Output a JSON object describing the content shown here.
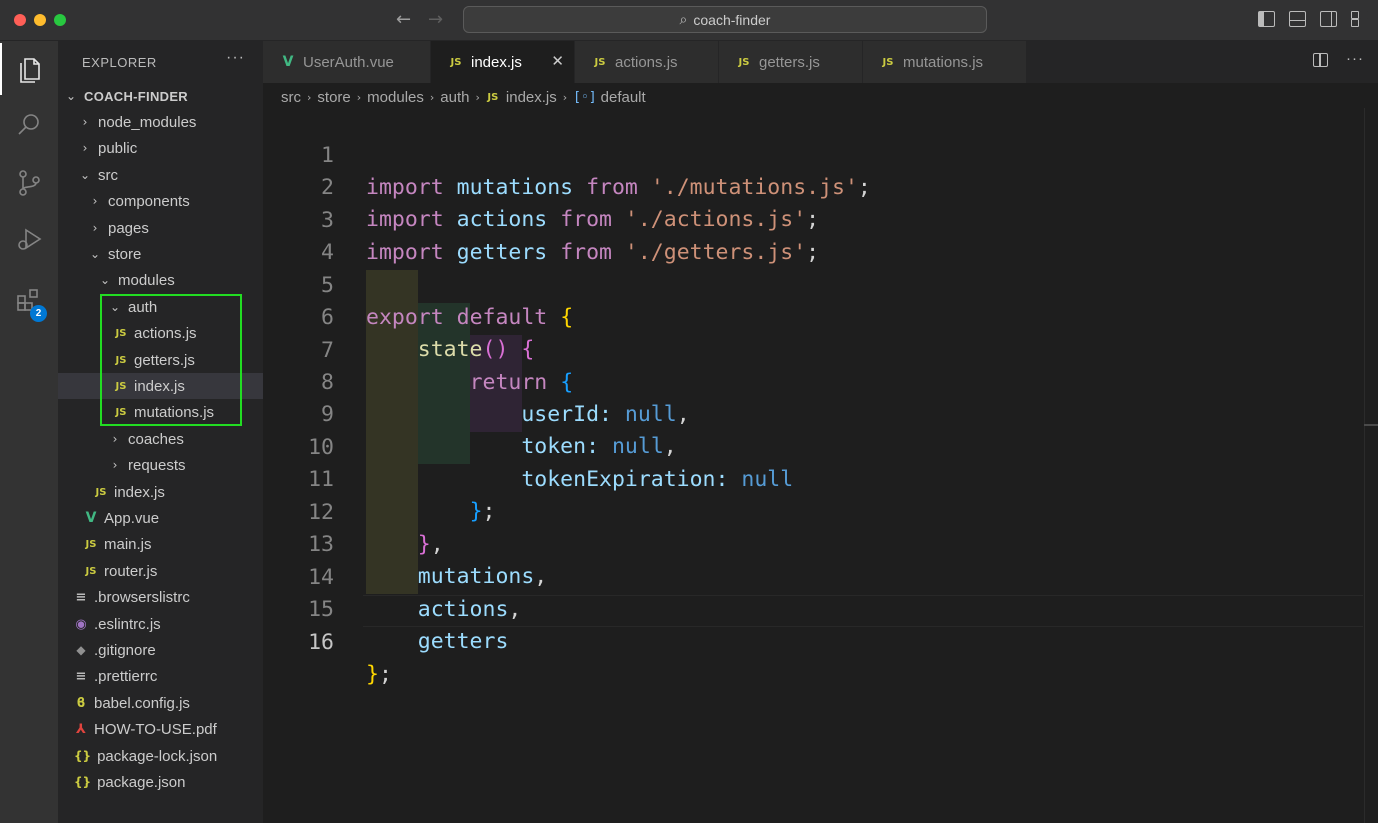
{
  "window": {
    "search_label": "coach-finder"
  },
  "activity": {
    "extensions_badge": "2"
  },
  "explorer": {
    "header": "EXPLORER",
    "more": "···",
    "root": "COACH-FINDER",
    "items": [
      {
        "label": "node_modules",
        "type": "folder",
        "expanded": false
      },
      {
        "label": "public",
        "type": "folder",
        "expanded": false
      },
      {
        "label": "src",
        "type": "folder",
        "expanded": true
      },
      {
        "label": "components",
        "type": "folder",
        "expanded": false
      },
      {
        "label": "pages",
        "type": "folder",
        "expanded": false
      },
      {
        "label": "store",
        "type": "folder",
        "expanded": true
      },
      {
        "label": "modules",
        "type": "folder",
        "expanded": true
      },
      {
        "label": "auth",
        "type": "folder",
        "expanded": true
      },
      {
        "label": "actions.js",
        "type": "js"
      },
      {
        "label": "getters.js",
        "type": "js"
      },
      {
        "label": "index.js",
        "type": "js",
        "selected": true
      },
      {
        "label": "mutations.js",
        "type": "js"
      },
      {
        "label": "coaches",
        "type": "folder",
        "expanded": false
      },
      {
        "label": "requests",
        "type": "folder",
        "expanded": false
      },
      {
        "label": "index.js",
        "type": "js"
      },
      {
        "label": "App.vue",
        "type": "vue"
      },
      {
        "label": "main.js",
        "type": "js"
      },
      {
        "label": "router.js",
        "type": "js"
      },
      {
        "label": ".browserslistrc",
        "type": "lines"
      },
      {
        "label": ".eslintrc.js",
        "type": "eslint"
      },
      {
        "label": ".gitignore",
        "type": "git"
      },
      {
        "label": ".prettierrc",
        "type": "lines"
      },
      {
        "label": "babel.config.js",
        "type": "babel"
      },
      {
        "label": "HOW-TO-USE.pdf",
        "type": "pdf"
      },
      {
        "label": "package-lock.json",
        "type": "json"
      },
      {
        "label": "package.json",
        "type": "json"
      }
    ],
    "js_icon": "JS",
    "vue_icon": "V",
    "json_icon": "{}"
  },
  "tabs": [
    {
      "label": "UserAuth.vue",
      "icon": "vue-icon",
      "active": false
    },
    {
      "label": "index.js",
      "icon": "js-icon",
      "active": true
    },
    {
      "label": "actions.js",
      "icon": "js-icon",
      "active": false
    },
    {
      "label": "getters.js",
      "icon": "js-icon",
      "active": false
    },
    {
      "label": "mutations.js",
      "icon": "js-icon",
      "active": false
    }
  ],
  "breadcrumb": [
    "src",
    "store",
    "modules",
    "auth",
    "index.js",
    "default"
  ],
  "editor": {
    "line_numbers": [
      "1",
      "2",
      "3",
      "4",
      "5",
      "6",
      "7",
      "8",
      "9",
      "10",
      "11",
      "12",
      "13",
      "14",
      "15",
      "16"
    ],
    "current_line": "16",
    "colors": {
      "keyword": "#c586c0",
      "variable": "#9cdcfe",
      "string": "#ce9178",
      "constant": "#569cd6",
      "bracket1": "#ffd700",
      "bracket2": "#da70d6",
      "bracket3": "#179fff"
    },
    "tokens": {
      "import": "import",
      "from": "from",
      "export": "export",
      "default": "default",
      "return": "return",
      "null": "null",
      "mutations": "mutations",
      "actions": "actions",
      "getters": "getters",
      "str_mutations": "'./mutations.js'",
      "str_actions": "'./actions.js'",
      "str_getters": "'./getters.js'",
      "state": "state",
      "userId": "userId",
      "token": "token",
      "tokenExpiration": "tokenExpiration",
      "semi": ";",
      "comma": ",",
      "colon": ":",
      "lbrace": "{",
      "rbrace": "}",
      "parens": "()"
    }
  }
}
